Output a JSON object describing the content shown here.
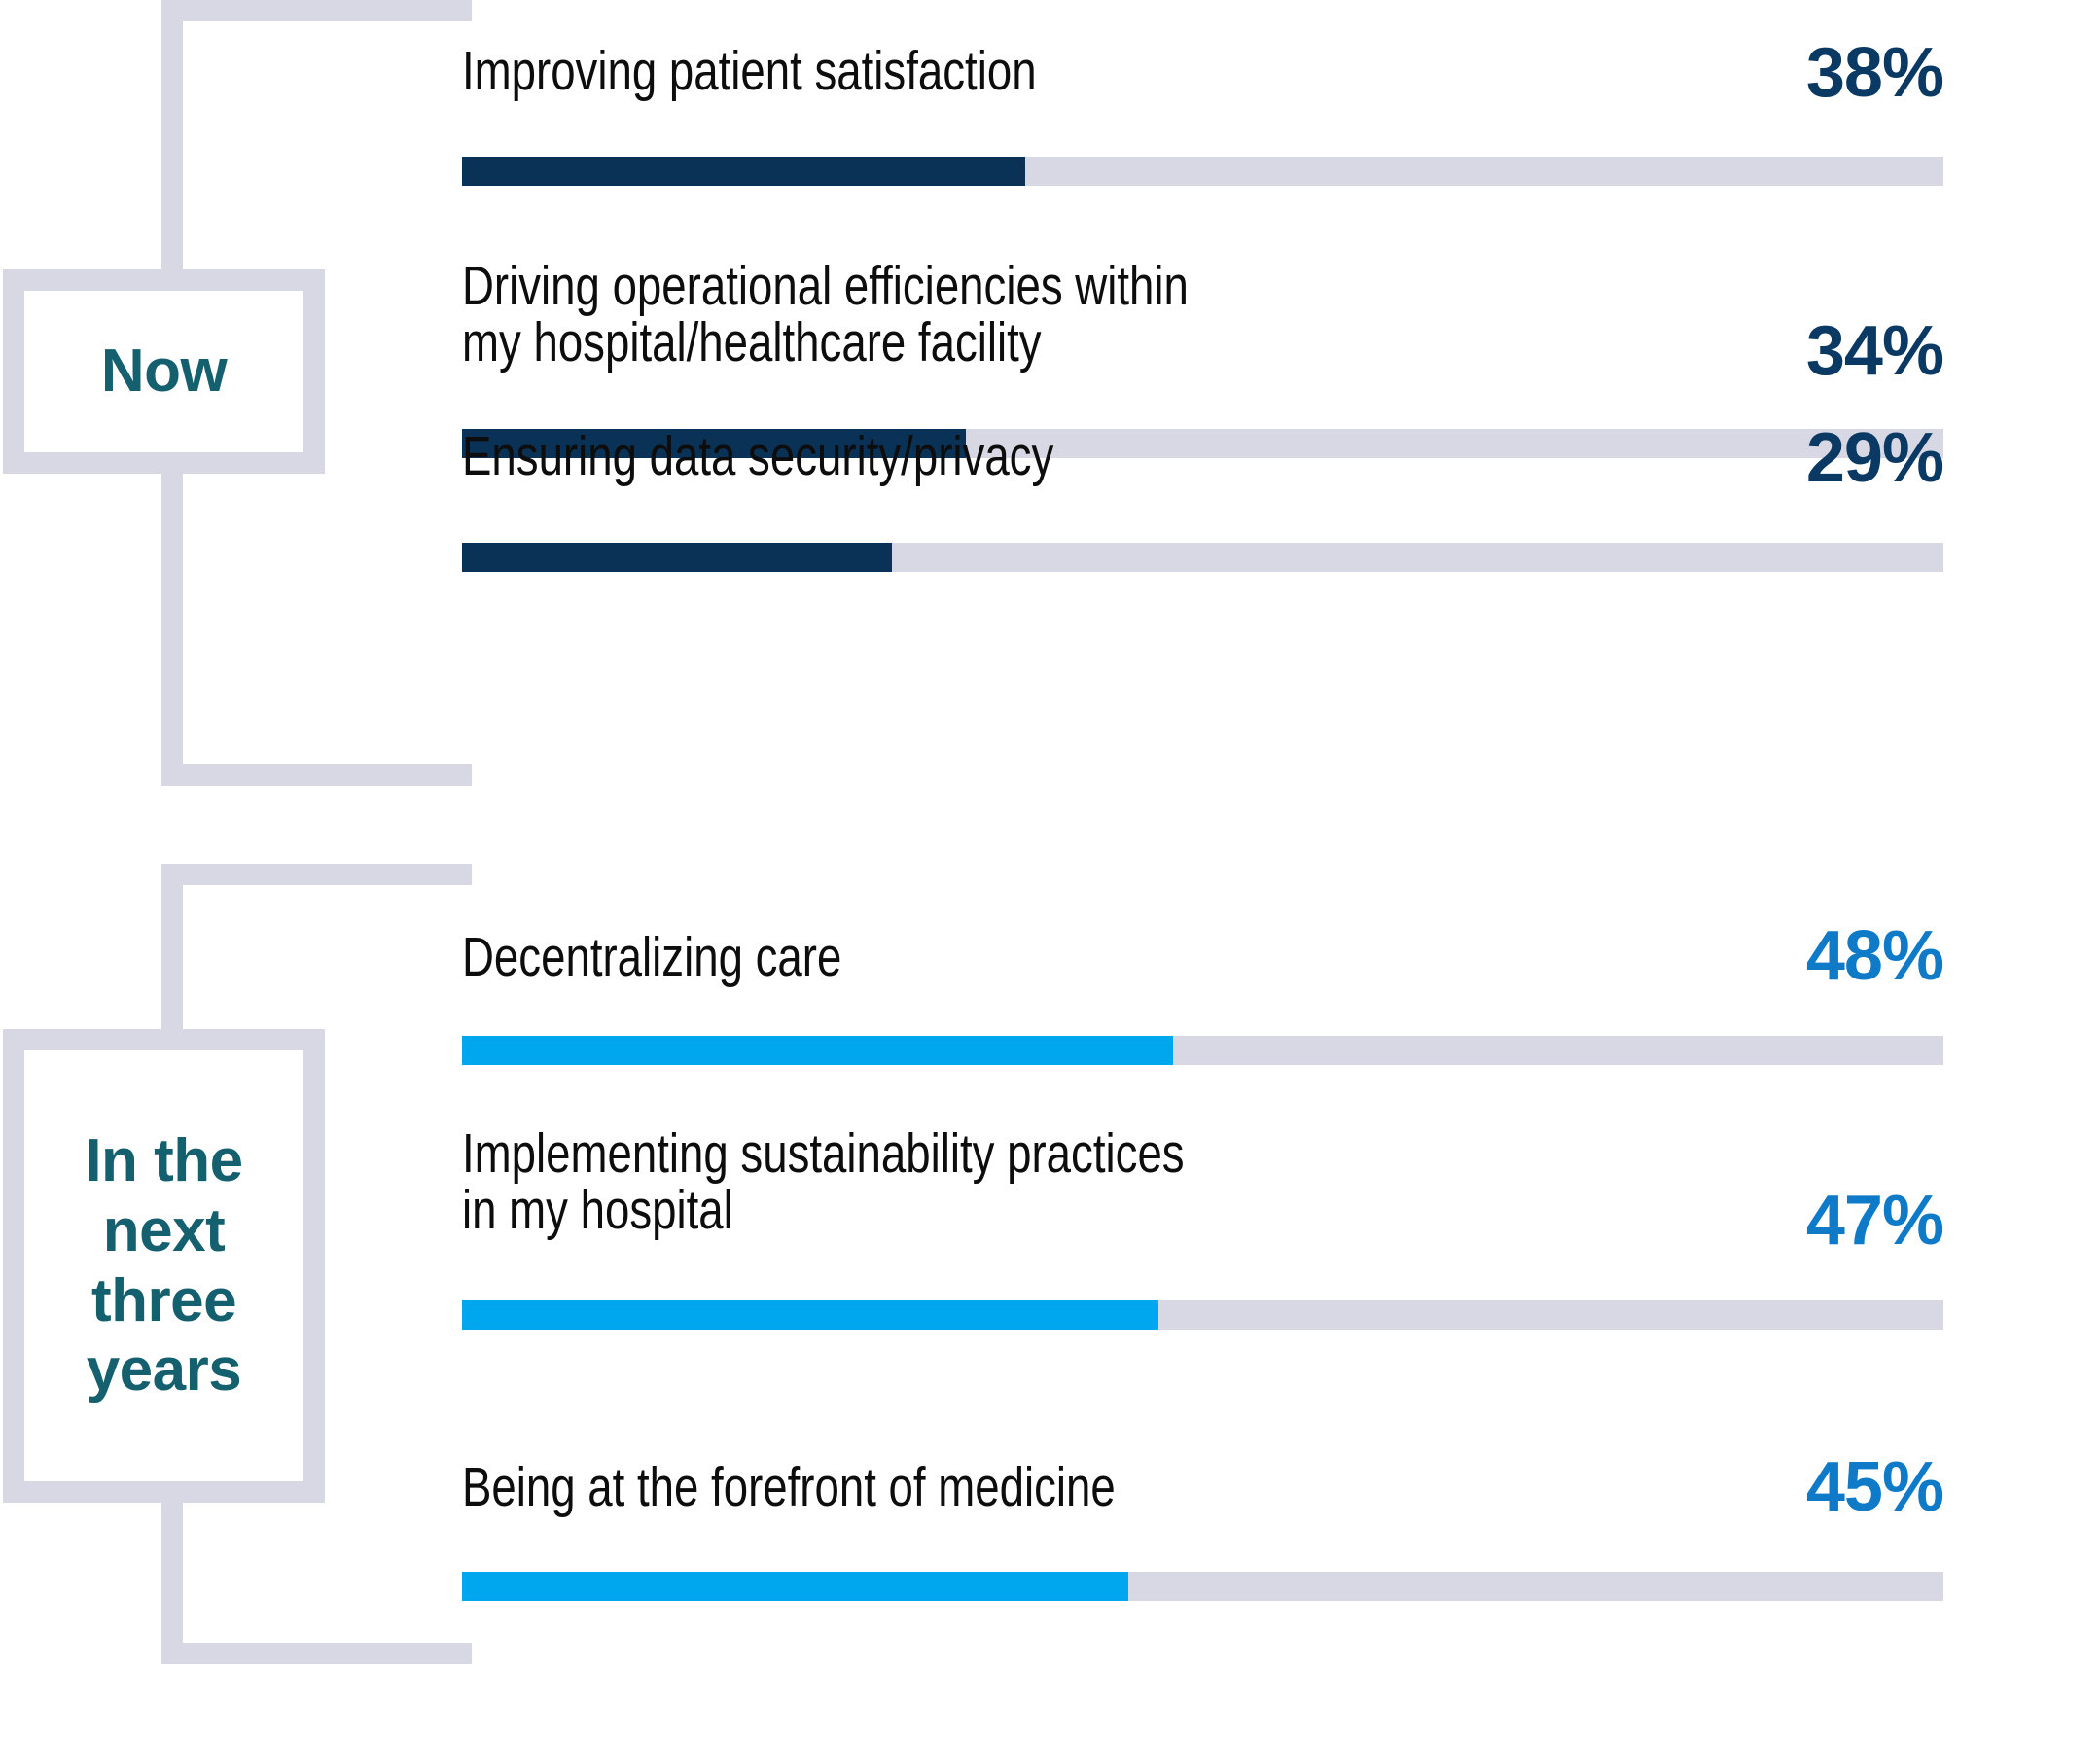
{
  "chart_data": {
    "type": "bar",
    "title": "",
    "orientation": "horizontal",
    "xlabel": "",
    "ylabel": "",
    "xlim": [
      0,
      100
    ],
    "grid": false,
    "legend_position": "none",
    "groups": [
      {
        "name": "Now",
        "color": "#0a3156",
        "value_color": "#0a3a64",
        "categories": [
          "Improving patient satisfaction",
          "Driving operational efficiencies within\nmy hospital/healthcare facility",
          "Ensuring data security/privacy"
        ],
        "values": [
          38,
          34,
          29
        ],
        "value_labels": [
          "38%",
          "34%",
          "29%"
        ]
      },
      {
        "name": "In the next three years",
        "color": "#00a6ee",
        "value_color": "#0e7ac8",
        "categories": [
          "Decentralizing care",
          "Implementing sustainability practices\nin my hospital",
          "Being at the forefront of medicine"
        ],
        "values": [
          48,
          47,
          45
        ],
        "value_labels": [
          "48%",
          "47%",
          "45%"
        ]
      }
    ]
  },
  "colors": {
    "bracket": "#d7d8e3",
    "track": "#d7d8e3",
    "now_bar": "#0a3156",
    "now_value": "#0a3a64",
    "future_bar": "#00a6ee",
    "future_value": "#0e7ac8",
    "period_text": "#15606e",
    "label_text": "#0d0d0d"
  },
  "sections": {
    "now": {
      "period_label": "Now",
      "rows": [
        {
          "label": "Improving patient satisfaction",
          "value_label": "38%",
          "value": 38
        },
        {
          "label": "Driving operational efficiencies within\nmy hospital/healthcare facility",
          "value_label": "34%",
          "value": 34
        },
        {
          "label": "Ensuring data security/privacy",
          "value_label": "29%",
          "value": 29
        }
      ]
    },
    "future": {
      "period_label": "In the\nnext\nthree\nyears",
      "rows": [
        {
          "label": "Decentralizing care",
          "value_label": "48%",
          "value": 48
        },
        {
          "label": "Implementing sustainability practices\nin my hospital",
          "value_label": "47%",
          "value": 47
        },
        {
          "label": "Being at the forefront of medicine",
          "value_label": "45%",
          "value": 45
        }
      ]
    }
  }
}
